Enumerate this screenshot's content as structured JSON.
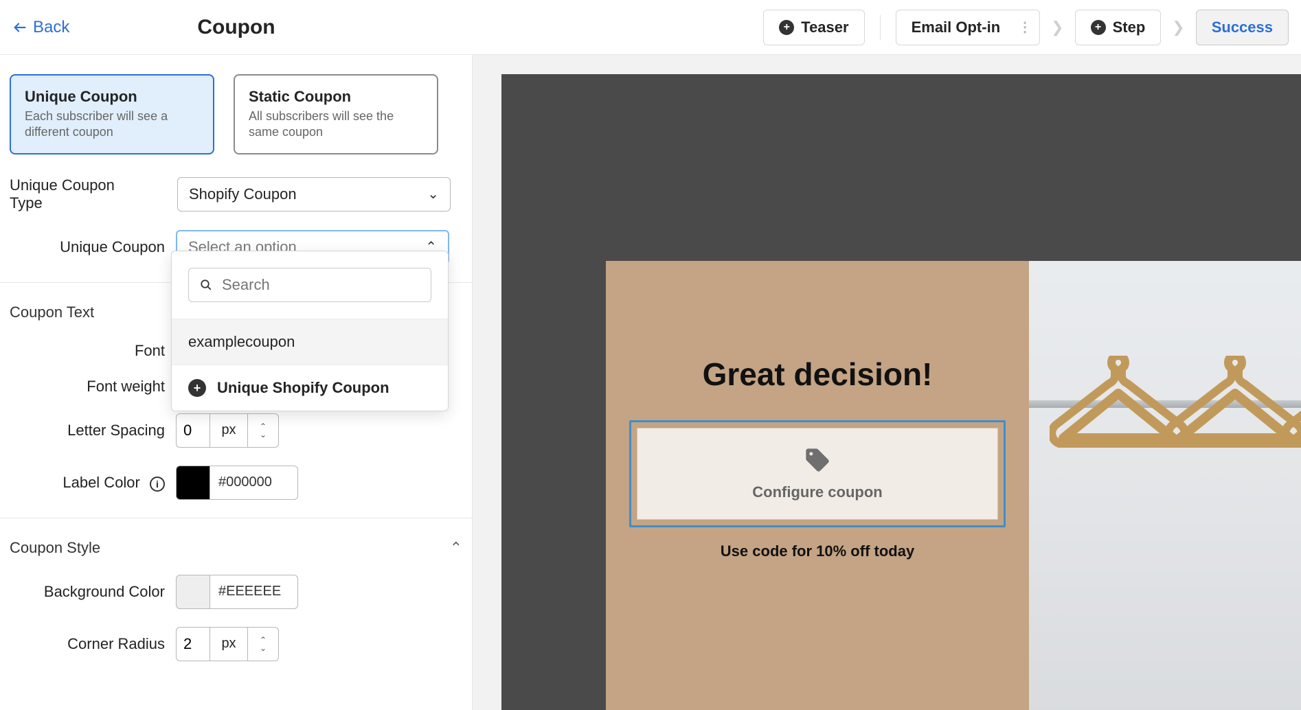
{
  "header": {
    "back_label": "Back",
    "title": "Coupon",
    "steps": {
      "teaser": "Teaser",
      "email_optin": "Email Opt-in",
      "step": "Step",
      "success": "Success"
    }
  },
  "coupon_type": {
    "unique": {
      "title": "Unique Coupon",
      "desc": "Each subscriber will see a different coupon"
    },
    "static": {
      "title": "Static Coupon",
      "desc": "All subscribers will see the same coupon"
    }
  },
  "form": {
    "unique_type_label": "Unique Coupon Type",
    "unique_type_value": "Shopify Coupon",
    "unique_coupon_label": "Unique Coupon",
    "unique_coupon_placeholder": "Select an option"
  },
  "dropdown": {
    "search_placeholder": "Search",
    "options": [
      "examplecoupon"
    ],
    "add_label": "Unique Shopify Coupon"
  },
  "text_section": {
    "title": "Coupon Text",
    "font_label": "Font",
    "font_weight_label": "Font weight",
    "letter_spacing_label": "Letter Spacing",
    "letter_spacing_value": "0",
    "unit": "px",
    "label_color_label": "Label Color",
    "label_color_hex": "000000",
    "label_color_swatch": "#000000"
  },
  "style_section": {
    "title": "Coupon Style",
    "bg_label": "Background Color",
    "bg_hex": "EEEEEE",
    "bg_swatch": "#EEEEEE",
    "radius_label": "Corner Radius",
    "radius_value": "2",
    "unit": "px"
  },
  "preview": {
    "title": "Great decision!",
    "configure": "Configure coupon",
    "subtitle": "Use code for 10% off today"
  }
}
